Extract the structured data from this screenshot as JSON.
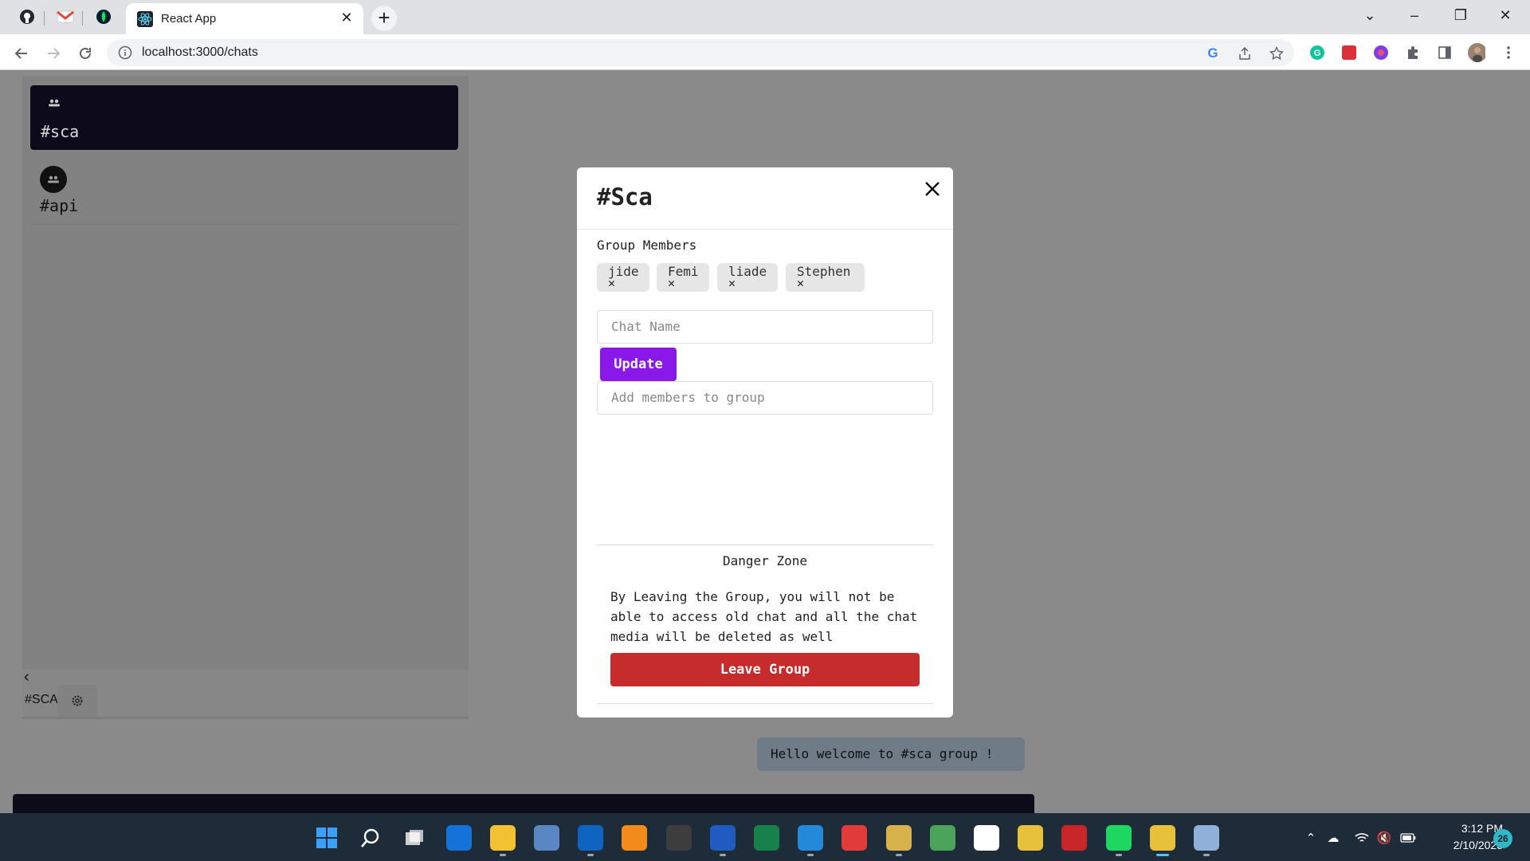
{
  "browser": {
    "tab_title": "React App",
    "url": "localhost:3000/chats",
    "pinned_tabs": [
      "github-icon",
      "gmail-icon",
      "mongodb-icon"
    ]
  },
  "sidebar": {
    "chats": [
      {
        "name": "#sca",
        "active": true
      },
      {
        "name": "#api",
        "active": false
      }
    ],
    "current_chat": "#SCA"
  },
  "chat": {
    "message": "Hello welcome to #sca group !"
  },
  "modal": {
    "title": "#Sca",
    "members_label": "Group Members",
    "members": [
      "jide",
      "Femi",
      "liade",
      "Stephen"
    ],
    "remove_glyph": "✕",
    "chat_name_placeholder": "Chat Name",
    "update_label": "Update",
    "add_members_placeholder": "Add members to group",
    "danger_zone_title": "Danger Zone",
    "danger_zone_text": "By Leaving the Group, you will not be able to access old chat and all the chat media will be deleted as well",
    "leave_label": "Leave Group"
  },
  "taskbar": {
    "time": "3:12 PM",
    "date": "2/10/2023",
    "notification_count": "26",
    "apps": [
      {
        "name": "start-icon",
        "color": "#3aa0ff"
      },
      {
        "name": "search-icon",
        "color": "#1e2c3a"
      },
      {
        "name": "task-view-icon",
        "color": "#1e2c3a"
      },
      {
        "name": "mail-icon",
        "color": "#1572d9"
      },
      {
        "name": "file-explorer-icon",
        "color": "#f2c233"
      },
      {
        "name": "remote-desktop-icon",
        "color": "#5b86c4"
      },
      {
        "name": "outlook-icon",
        "color": "#0f64c2"
      },
      {
        "name": "vlc-icon",
        "color": "#f28a1c"
      },
      {
        "name": "terminal-icon",
        "color": "#3d3d3d"
      },
      {
        "name": "word-icon",
        "color": "#1f5bc0"
      },
      {
        "name": "excel-icon",
        "color": "#18804a"
      },
      {
        "name": "vscode-icon",
        "color": "#2489d9"
      },
      {
        "name": "git-icon",
        "color": "#e23b3b"
      },
      {
        "name": "toolbox-icon",
        "color": "#d7b24a"
      },
      {
        "name": "notepad-icon",
        "color": "#4aa55b"
      },
      {
        "name": "slack-icon",
        "color": "#ffffff"
      },
      {
        "name": "chrome-icon",
        "color": "#e8c13a"
      },
      {
        "name": "filezilla-icon",
        "color": "#c9262a"
      },
      {
        "name": "spotify-icon",
        "color": "#1ed760"
      },
      {
        "name": "chrome-active-icon",
        "color": "#e8c13a"
      },
      {
        "name": "network-manager-icon",
        "color": "#8fb0d8"
      }
    ]
  }
}
